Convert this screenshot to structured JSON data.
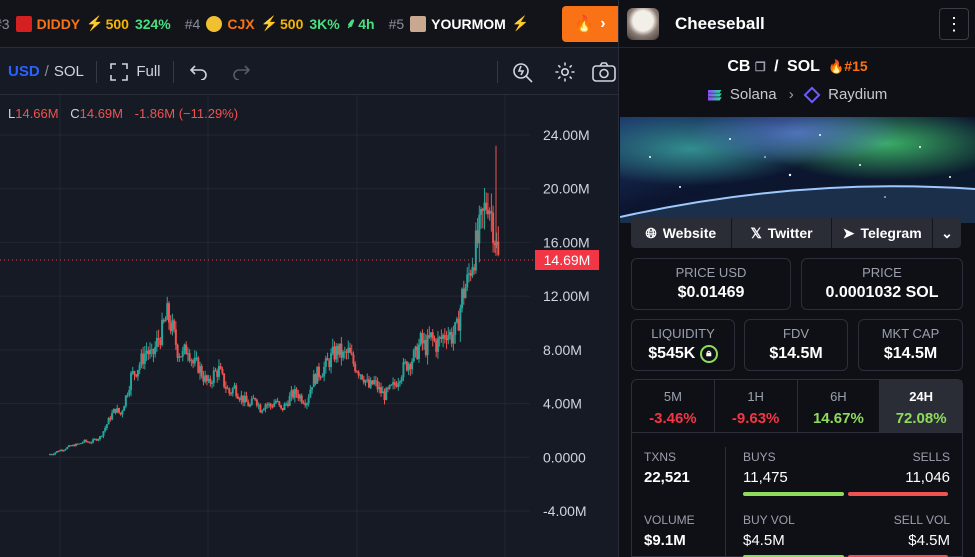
{
  "ticker": [
    {
      "rank": "#3",
      "symbol": "DIDDY",
      "boost": "500",
      "change": "324%",
      "avatar_color": "#d42020",
      "symbol_color": "#f97316",
      "extra": ""
    },
    {
      "rank": "#4",
      "symbol": "CJX",
      "boost": "500",
      "change": "3K%",
      "avatar_color": "#f0c030",
      "symbol_color": "#f97316",
      "extra": "4h"
    },
    {
      "rank": "#5",
      "symbol": "YOURMOM",
      "boost": "",
      "change": "",
      "avatar_color": "#c8a890",
      "symbol_color": "#ffffff",
      "extra": ""
    }
  ],
  "toolbar": {
    "currency_usd": "USD",
    "currency_sep": "/",
    "currency_sol": "SOL",
    "full_label": "Full"
  },
  "ohlc": {
    "low_label": "L",
    "low_value": "14.66M",
    "close_label": "C",
    "close_value": "14.69M",
    "change": "-1.86M (−11.29%)"
  },
  "price_axis": {
    "ticks": [
      "24.00M",
      "20.00M",
      "16.00M",
      "12.00M",
      "8.00M",
      "4.00M",
      "0.0000",
      "-4.00M"
    ],
    "current_label": "14.69M"
  },
  "chart_data": {
    "type": "candlestick",
    "y_unit": "USD market cap",
    "ylim": [
      -4000000,
      24000000
    ],
    "last_price": 14690000,
    "series": [
      {
        "name": "candles",
        "close": [
          0.2,
          0.3,
          0.5,
          0.6,
          0.8,
          0.9,
          1.0,
          1.2,
          1.1,
          1.3,
          1.5,
          2.2,
          3.0,
          3.6,
          3.2,
          4.5,
          6.0,
          6.5,
          7.2,
          8.0,
          7.4,
          8.5,
          9.4,
          10.6,
          9.5,
          8.0,
          7.6,
          8.3,
          7.0,
          6.8,
          6.0,
          5.4,
          6.2,
          6.5,
          5.5,
          4.8,
          5.2,
          4.6,
          4.2,
          3.8,
          4.5,
          3.6,
          4.0,
          3.8,
          4.2,
          3.5,
          4.0,
          4.6,
          4.8,
          4.4,
          4.2,
          5.6,
          6.2,
          6.5,
          7.0,
          7.6,
          8.0,
          7.5,
          7.8,
          7.0,
          6.5,
          6.0,
          5.2,
          5.6,
          5.0,
          4.6,
          5.0,
          5.4,
          6.2,
          6.8,
          7.2,
          7.6,
          8.6,
          8.2,
          8.9,
          8.4,
          8.8,
          9.4,
          9.0,
          9.5,
          12.0,
          13.0,
          14.8,
          16.0,
          17.8,
          19.5,
          17.5,
          14.69
        ]
      }
    ]
  },
  "right": {
    "token_name": "Cheeseball",
    "pair_base": "CB",
    "pair_sep": "/",
    "pair_quote": "SOL",
    "rank": "#15",
    "chain": "Solana",
    "dex": "Raydium",
    "links": [
      "Website",
      "Twitter",
      "Telegram"
    ],
    "price_usd_label": "PRICE USD",
    "price_usd": "$0.01469",
    "price_label": "PRICE",
    "price_sol": "0.0001032 SOL",
    "liquidity_label": "LIQUIDITY",
    "liquidity": "$545K",
    "fdv_label": "FDV",
    "fdv": "$14.5M",
    "mcap_label": "MKT CAP",
    "mcap": "$14.5M",
    "timeframes": [
      {
        "label": "5M",
        "change": "-3.46%",
        "color": "#f23645"
      },
      {
        "label": "1H",
        "change": "-9.63%",
        "color": "#f23645"
      },
      {
        "label": "6H",
        "change": "14.67%",
        "color": "#8fdc5c"
      },
      {
        "label": "24H",
        "change": "72.08%",
        "color": "#8fdc5c"
      }
    ],
    "txns_label": "TXNS",
    "txns": "22,521",
    "buys_label": "BUYS",
    "buys": "11,475",
    "sells_label": "SELLS",
    "sells": "11,046",
    "volume_label": "VOLUME",
    "volume": "$9.1M",
    "buy_vol_label": "BUY VOL",
    "buy_vol": "$4.5M",
    "sell_vol_label": "SELL VOL",
    "sell_vol": "$4.5M",
    "colors": {
      "buy": "#8fdc5c",
      "sell": "#f05252",
      "accent": "#f97316"
    }
  }
}
